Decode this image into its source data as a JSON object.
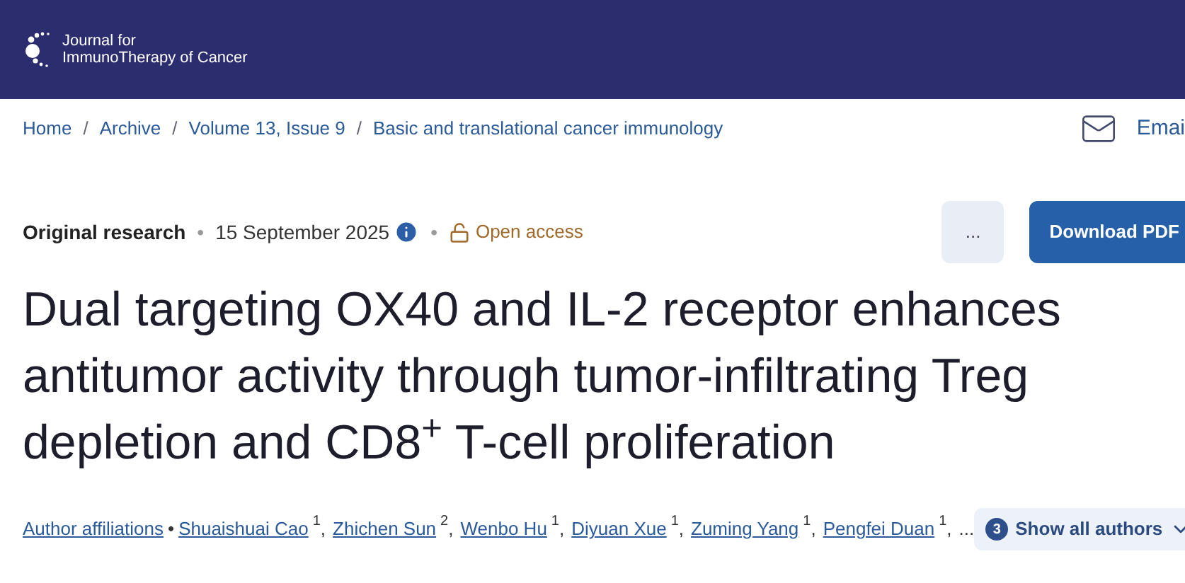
{
  "header": {
    "logo_line1": "Journal for",
    "logo_line2": "ImmunoTherapy of Cancer"
  },
  "breadcrumb": [
    "Home",
    "Archive",
    "Volume 13, Issue 9",
    "Basic and translational cancer immunology"
  ],
  "breadcrumb_separator": "/",
  "dot_separator": "•",
  "comma": ",",
  "email_link": "Emai",
  "meta": {
    "type": "Original research",
    "date": "15 September 2025",
    "access": "Open access"
  },
  "more_button": "...",
  "download_button": "Download PDF",
  "title": "Dual targeting OX40 and IL-2 receptor enhances antitumor activity through tumor-infiltrating Treg depletion and CD8$^{+}$ T-cell proliferation",
  "author_affiliations": "Author affiliations",
  "authors": [
    {
      "name": "Shuaishuai Cao",
      "aff": "1"
    },
    {
      "name": "Zhichen Sun",
      "aff": "2"
    },
    {
      "name": "Wenbo Hu",
      "aff": "1"
    },
    {
      "name": "Diyuan Xue",
      "aff": "1"
    },
    {
      "name": "Zuming Yang",
      "aff": "1"
    },
    {
      "name": "Pengfei Duan",
      "aff": "1"
    }
  ],
  "ellipsis": "...",
  "show_all": {
    "count": "3",
    "label": "Show all authors"
  }
}
